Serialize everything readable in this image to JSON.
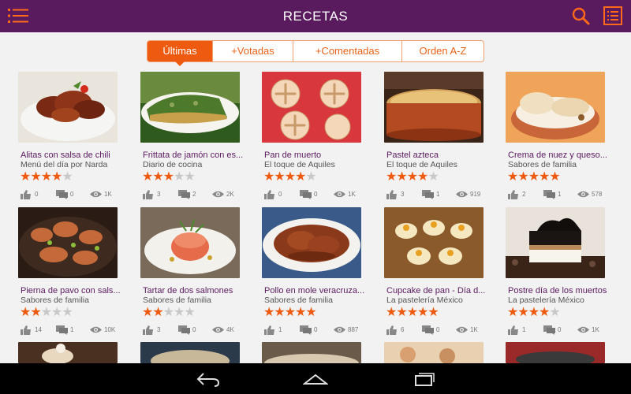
{
  "app": {
    "title": "RECETAS"
  },
  "tabs": [
    {
      "label": "Últimas",
      "active": true
    },
    {
      "label": "+Votadas",
      "active": false
    },
    {
      "label": "+Comentadas",
      "active": false
    },
    {
      "label": "Orden A-Z",
      "active": false
    }
  ],
  "colors": {
    "header": "#5a1a5e",
    "accent": "#ee5a10",
    "title_text": "#5a1a5e"
  },
  "recipes": [
    {
      "name": "Alitas con salsa de chili",
      "source": "Menú del día por Narda",
      "rating": 4,
      "likes": "0",
      "comments": "0",
      "views": "1K"
    },
    {
      "name": "Frittata de jamón con es...",
      "source": "Diario de cocina",
      "rating": 3,
      "likes": "3",
      "comments": "2",
      "views": "2K"
    },
    {
      "name": "Pan de muerto",
      "source": "El toque de Aquiles",
      "rating": 4,
      "likes": "0",
      "comments": "0",
      "views": "1K"
    },
    {
      "name": "Pastel azteca",
      "source": "El toque de Aquiles",
      "rating": 4,
      "likes": "3",
      "comments": "1",
      "views": "919"
    },
    {
      "name": "Crema de nuez y queso...",
      "source": "Sabores de familia",
      "rating": 5,
      "likes": "2",
      "comments": "1",
      "views": "578"
    },
    {
      "name": "Pierna de pavo con sals...",
      "source": "Sabores de familia",
      "rating": 2,
      "likes": "14",
      "comments": "1",
      "views": "10K"
    },
    {
      "name": "Tartar de dos salmones",
      "source": "Sabores de familia",
      "rating": 2,
      "likes": "3",
      "comments": "0",
      "views": "4K"
    },
    {
      "name": "Pollo en mole veracruza...",
      "source": "Sabores de familia",
      "rating": 5,
      "likes": "1",
      "comments": "0",
      "views": "887"
    },
    {
      "name": "Cupcake de pan - Día d...",
      "source": "La pastelería México",
      "rating": 5,
      "likes": "6",
      "comments": "0",
      "views": "1K"
    },
    {
      "name": "Postre día de los muertos",
      "source": "La pastelería México",
      "rating": 4,
      "likes": "1",
      "comments": "0",
      "views": "1K"
    }
  ],
  "icons": {
    "menu": "hamburger-list-icon",
    "search": "search-icon",
    "list": "list-view-icon",
    "like": "thumbs-up-icon",
    "comment": "comment-icon",
    "views": "eye-icon",
    "back": "back-icon",
    "home": "home-icon",
    "recents": "recents-icon"
  }
}
